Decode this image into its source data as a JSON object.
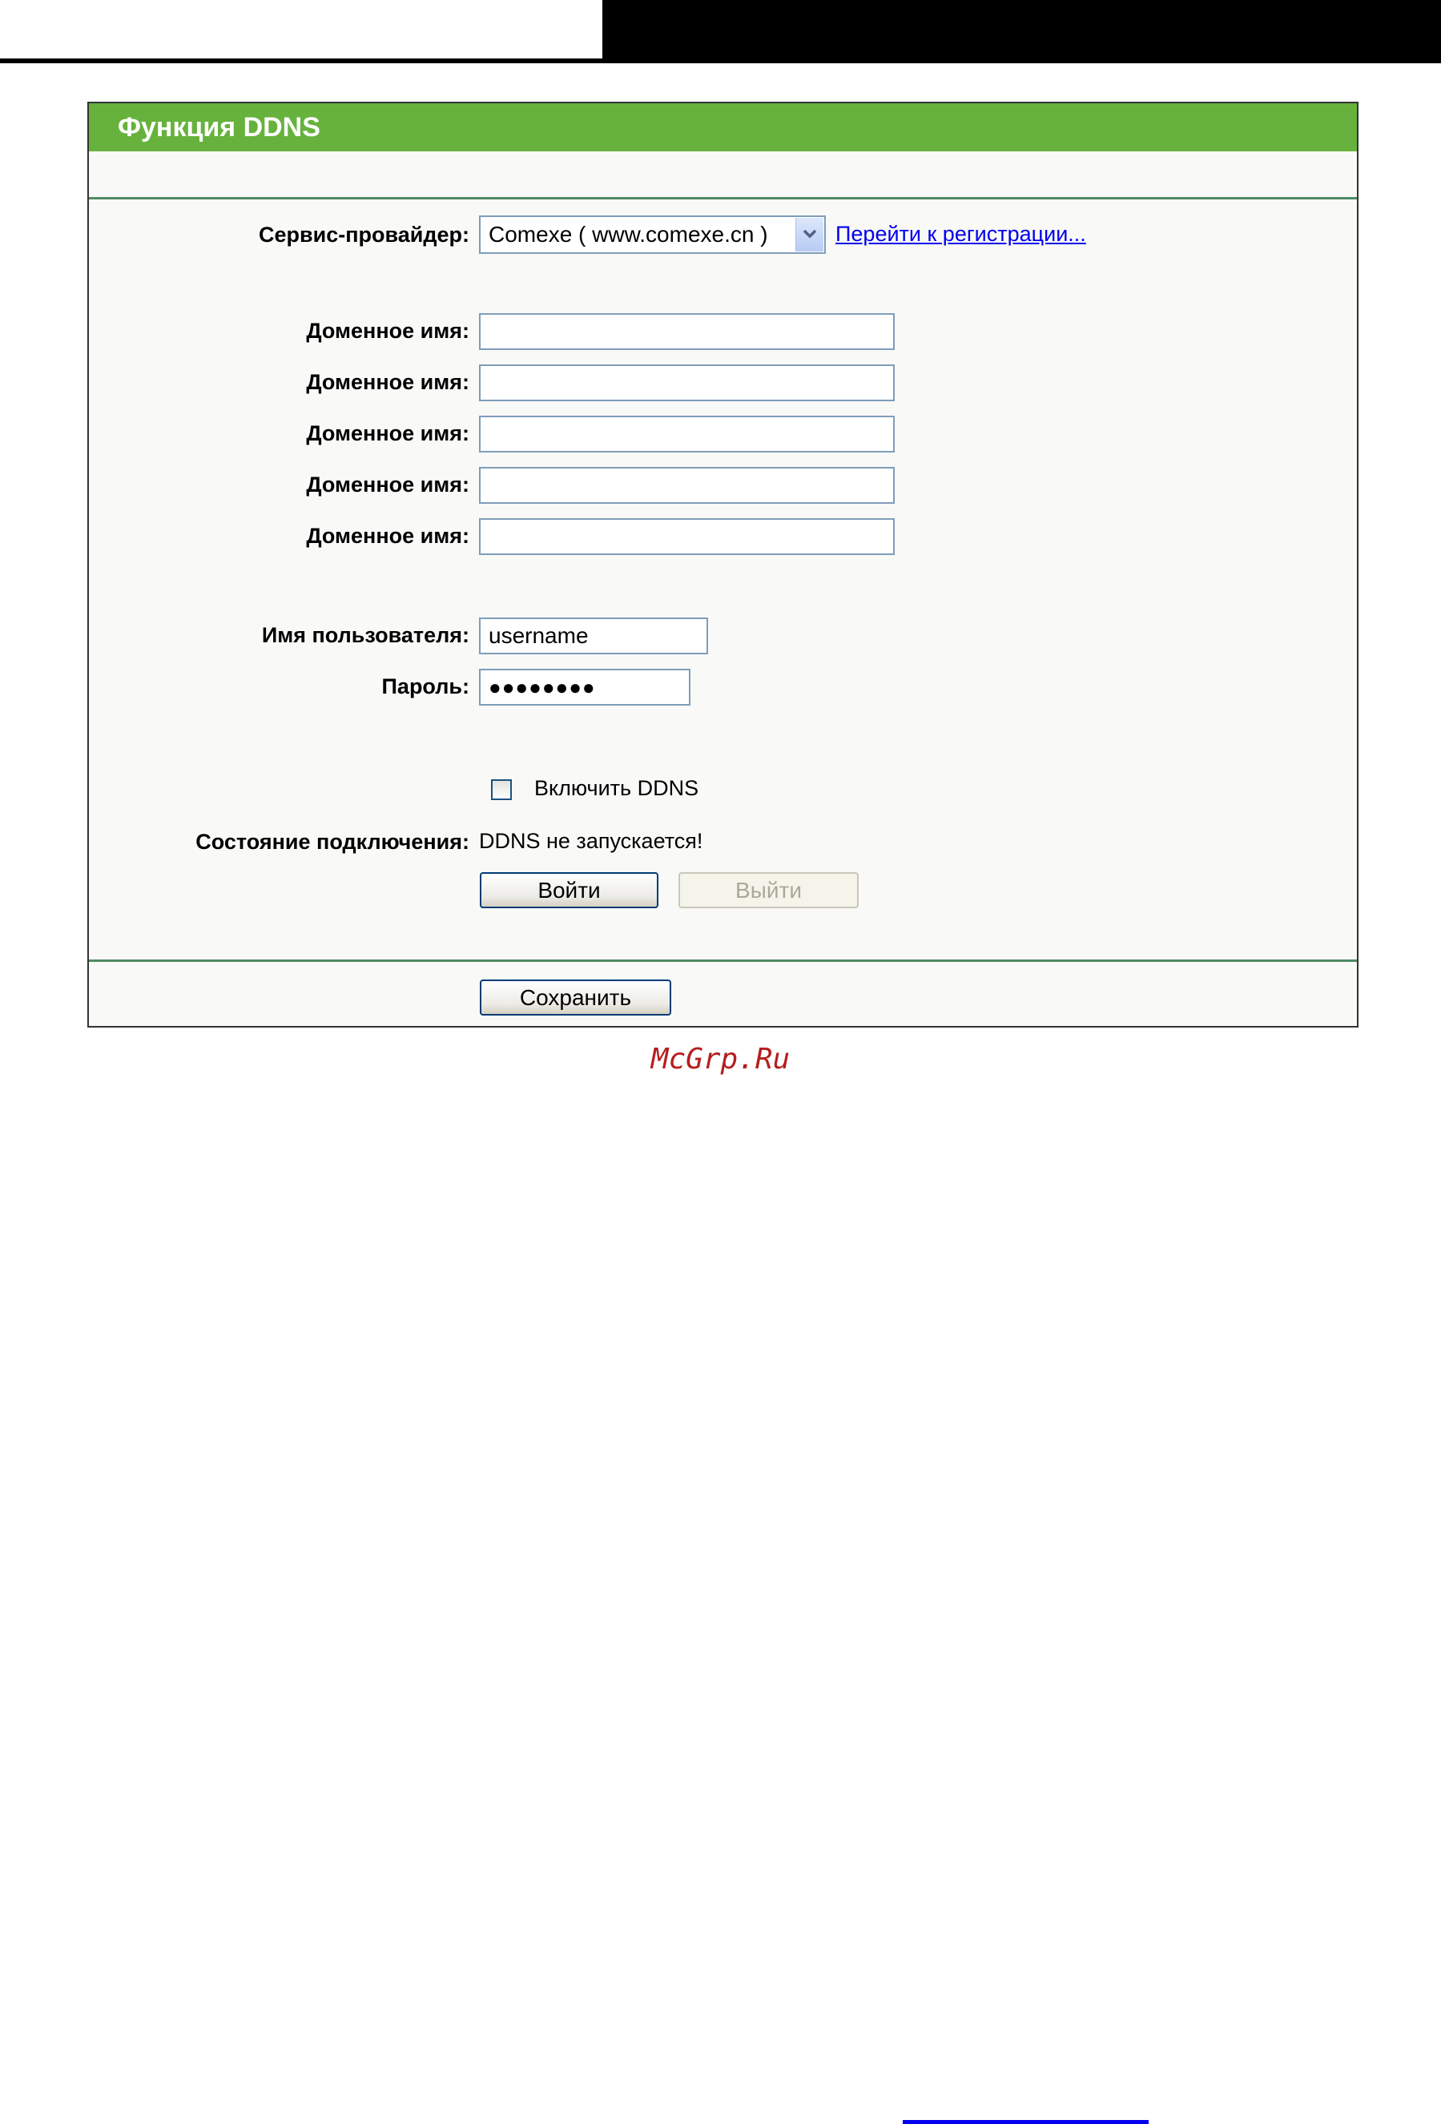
{
  "panel": {
    "title": "Функция DDNS"
  },
  "provider": {
    "label": "Сервис-провайдер:",
    "selected": "Comexe ( www.comexe.cn )",
    "register_link": "Перейти к регистрации..."
  },
  "domains": {
    "label": "Доменное имя:",
    "values": [
      "",
      "",
      "",
      "",
      ""
    ]
  },
  "account": {
    "username_label": "Имя пользователя:",
    "username_value": "username",
    "password_label": "Пароль:",
    "password_value": "●●●●●●●●"
  },
  "ddns": {
    "enable_label": "Включить DDNS",
    "enabled": false,
    "status_label": "Состояние подключения:",
    "status_value": "DDNS не запускается!",
    "login_button": "Войти",
    "logout_button": "Выйти"
  },
  "save_button": "Сохранить",
  "watermark": "McGrp.Ru",
  "colors": {
    "title_bar": "#66b23d",
    "divider": "#4f8a63",
    "link": "#0000ee",
    "watermark": "#b51e1e"
  }
}
